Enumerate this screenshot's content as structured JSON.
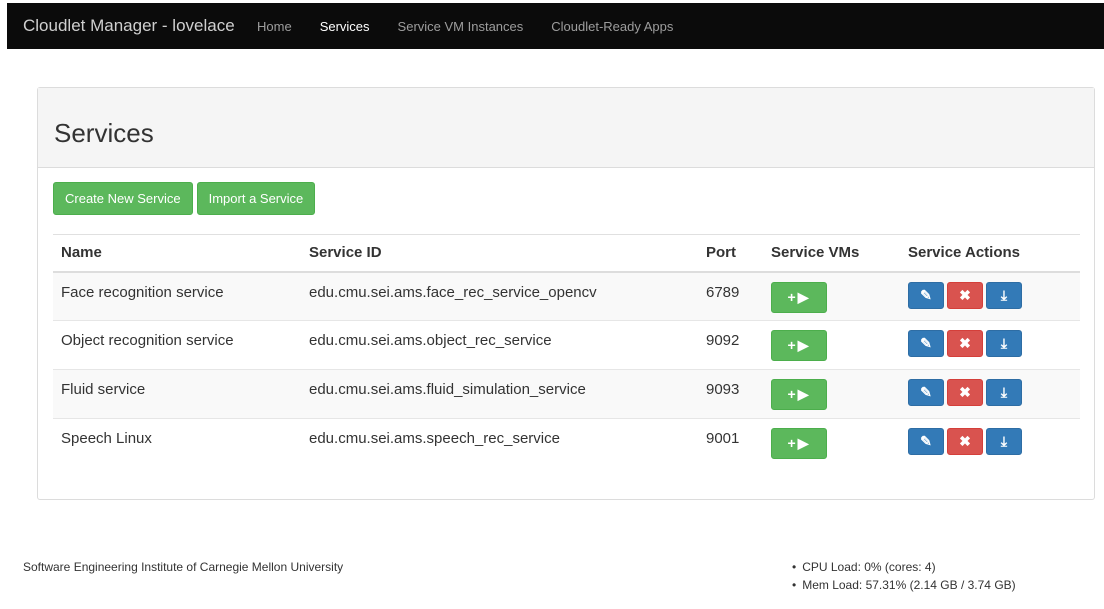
{
  "navbar": {
    "brand": "Cloudlet Manager - lovelace",
    "items": [
      {
        "label": "Home",
        "active": false
      },
      {
        "label": "Services",
        "active": true
      },
      {
        "label": "Service VM Instances",
        "active": false
      },
      {
        "label": "Cloudlet-Ready Apps",
        "active": false
      }
    ]
  },
  "page": {
    "title": "Services",
    "create_button": "Create New Service",
    "import_button": "Import a Service"
  },
  "table": {
    "headers": {
      "name": "Name",
      "service_id": "Service ID",
      "port": "Port",
      "service_vms": "Service VMs",
      "service_actions": "Service Actions"
    },
    "rows": [
      {
        "name": "Face recognition service",
        "service_id": "edu.cmu.sei.ams.face_rec_service_opencv",
        "port": "6789"
      },
      {
        "name": "Object recognition service",
        "service_id": "edu.cmu.sei.ams.object_rec_service",
        "port": "9092"
      },
      {
        "name": "Fluid service",
        "service_id": "edu.cmu.sei.ams.fluid_simulation_service",
        "port": "9093"
      },
      {
        "name": "Speech Linux",
        "service_id": "edu.cmu.sei.ams.speech_rec_service",
        "port": "9001"
      }
    ]
  },
  "icons": {
    "vm": "plus-play-icon",
    "edit": "edit-icon",
    "delete": "delete-x-icon",
    "download": "download-icon"
  },
  "colors": {
    "navbar": "#0b0b0b",
    "success": "#5cb85c",
    "primary": "#337ab7",
    "danger": "#d9534f"
  },
  "footer": {
    "institute": "Software Engineering Institute of Carnegie Mellon University",
    "cpu_load": "CPU Load: 0% (cores: 4)",
    "mem_load": "Mem Load: 57.31% (2.14 GB / 3.74 GB)"
  }
}
